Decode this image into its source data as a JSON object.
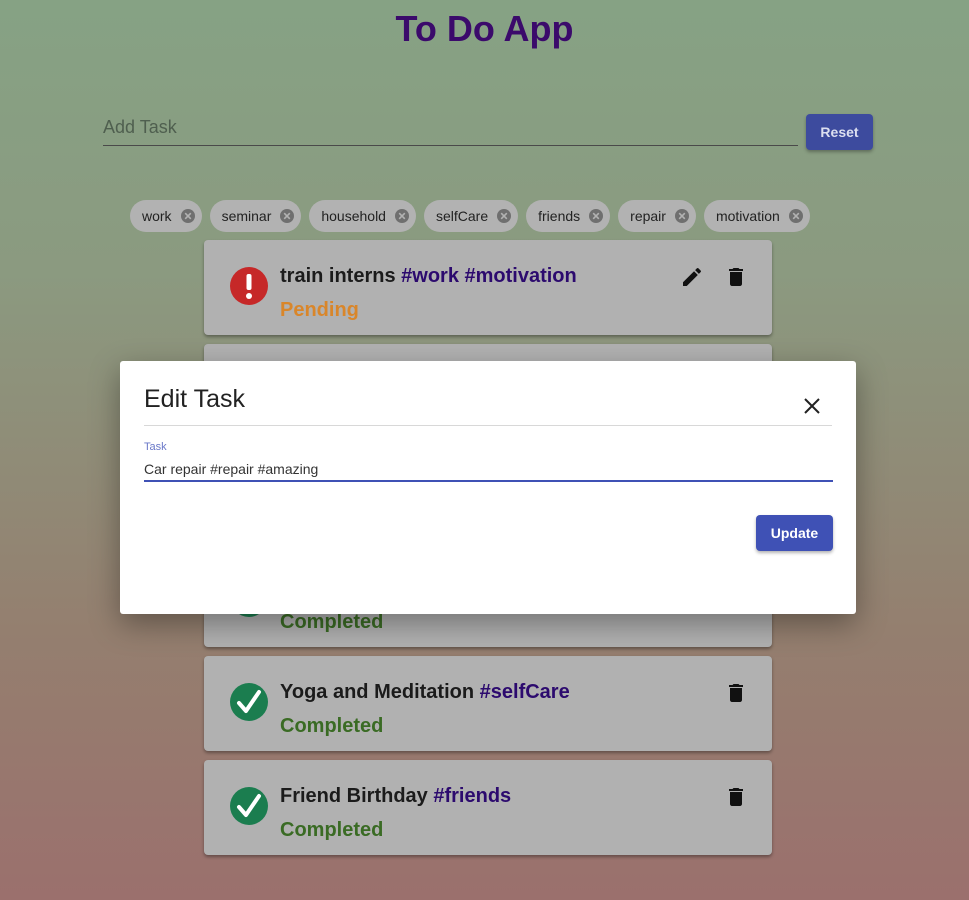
{
  "app": {
    "title": "To Do App"
  },
  "add_task": {
    "placeholder": "Add Task",
    "value": "",
    "reset_label": "Reset"
  },
  "tags": [
    "work",
    "seminar",
    "household",
    "selfCare",
    "friends",
    "repair",
    "motivation"
  ],
  "tasks": [
    {
      "title": "train interns",
      "tags": "#work #motivation",
      "status": "Pending",
      "editable": true
    },
    {
      "title": "",
      "tags": "",
      "status": "",
      "editable": false
    },
    {
      "title": "",
      "tags": "",
      "status": "Completed",
      "editable": false
    },
    {
      "title": "Yoga and Meditation",
      "tags": "#selfCare",
      "status": "Completed",
      "editable": false
    },
    {
      "title": "Friend Birthday",
      "tags": "#friends",
      "status": "Completed",
      "editable": false
    }
  ],
  "modal": {
    "title": "Edit Task",
    "field_label": "Task",
    "field_value": "Car repair #repair #amazing",
    "update_label": "Update"
  },
  "colors": {
    "title": "#3b0a6b",
    "primary": "#3f51b5",
    "pending": "#d9862a",
    "completed": "#3a6b24",
    "tag": "#2c0a6e",
    "pending_icon": "#c62828",
    "completed_icon": "#1b7d4f"
  },
  "icons": {
    "chip_close": "x-circle-icon",
    "pending": "exclamation-circle-icon",
    "completed": "checkmark-circle-icon",
    "edit": "pencil-icon",
    "delete": "trash-icon",
    "close": "close-icon"
  }
}
